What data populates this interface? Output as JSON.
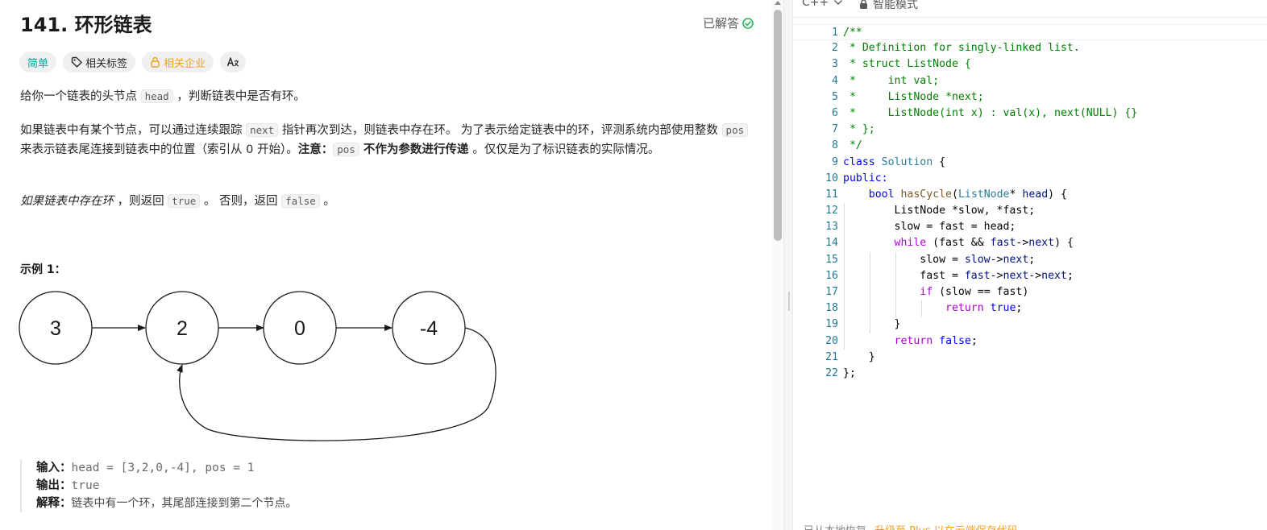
{
  "problem": {
    "title": "141. 环形链表",
    "status": "已解答",
    "tags": {
      "difficulty": "简单",
      "related_tags": "相关标签",
      "related_companies": "相关企业",
      "translate_icon": "Aあ"
    },
    "desc1": {
      "a": "给你一个链表的头节点 ",
      "code": "head",
      "b": " ，判断链表中是否有环。"
    },
    "desc2": {
      "a": "如果链表中有某个节点，可以通过连续跟踪 ",
      "code1": "next",
      "b": " 指针再次到达，则链表中存在环。 为了表示给定链表中的环，评测系统内部使用整数 ",
      "code2": "pos",
      "c": " 来表示链表尾连接到链表中的位置（索引从 0 开始）。",
      "note_label": "注意：",
      "code3": "pos",
      "strong": " 不作为参数进行传递 ",
      "d": "。仅仅是为了标识链表的实际情况。"
    },
    "desc3": {
      "em": "如果链表中存在环",
      "a": " ，则返回 ",
      "code1": "true",
      "b": " 。 否则，返回 ",
      "code2": "false",
      "c": " 。"
    },
    "example1": {
      "title": "示例 1：",
      "nodes": [
        "3",
        "2",
        "0",
        "-4"
      ],
      "input_label": "输入：",
      "input": "head = [3,2,0,-4], pos = 1",
      "output_label": "输出：",
      "output": "true",
      "explain_label": "解释：",
      "explain": "链表中有一个环，其尾部连接到第二个节点。"
    }
  },
  "editor": {
    "language": "C++",
    "mode": "智能模式",
    "line_numbers": [
      "1",
      "2",
      "3",
      "4",
      "5",
      "6",
      "7",
      "8",
      "9",
      "10",
      "11",
      "12",
      "13",
      "14",
      "15",
      "16",
      "17",
      "18",
      "19",
      "20",
      "21",
      "22"
    ]
  },
  "footer": {
    "left": "已从本地恢复",
    "warn": "升级至 Plus 以在云端保存代码"
  },
  "colors": {
    "easy": "#00a5a0",
    "company": "#f0a020",
    "solved_check": "#2db55d",
    "line_number": "#237893"
  }
}
